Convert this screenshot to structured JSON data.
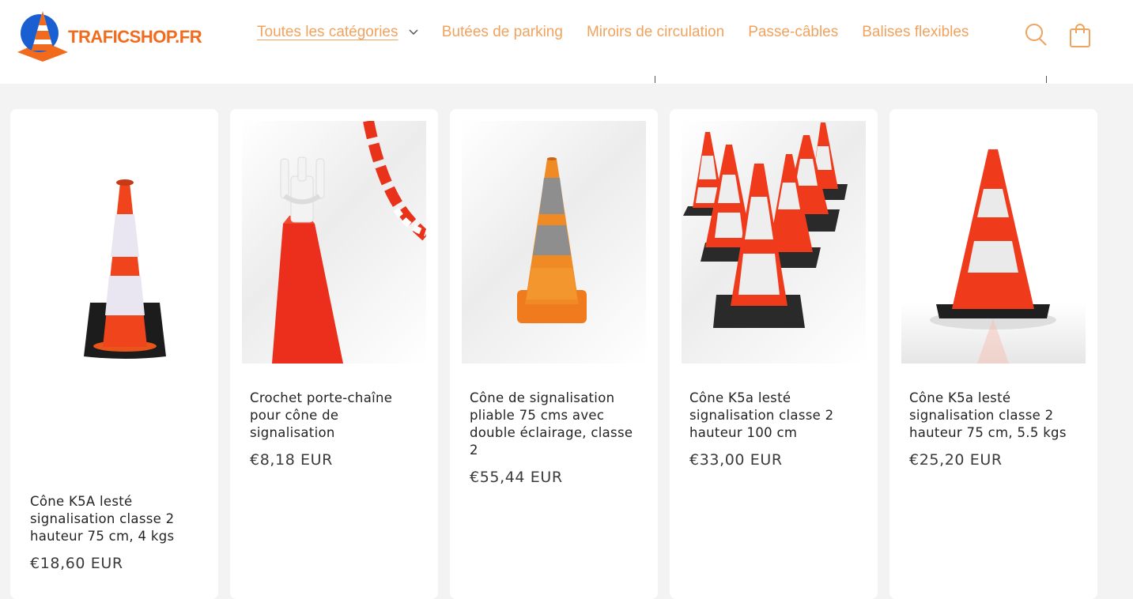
{
  "brand": {
    "name": "TRAFICSHOP.FR",
    "color": "#f26a1b"
  },
  "nav": {
    "items": [
      {
        "label": "Toutes les catégories",
        "has_dropdown": true,
        "active": true
      },
      {
        "label": "Butées de parking"
      },
      {
        "label": "Miroirs de circulation"
      },
      {
        "label": "Passe-câbles"
      },
      {
        "label": "Balises flexibles"
      }
    ],
    "color": "#f0a35e"
  },
  "header_icons": [
    "search-icon",
    "cart-icon"
  ],
  "products": [
    {
      "title": "Cône K5A lesté signalisation classe 2 hauteur 75 cm, 4 kgs",
      "price": "€18,60 EUR",
      "image": "single-cone-icon"
    },
    {
      "title": "Crochet porte-chaîne pour cône de signalisation",
      "price": "€8,18 EUR",
      "image": "chain-hook-icon"
    },
    {
      "title": "Cône de signalisation pliable 75 cms avec double éclairage, classe 2",
      "price": "€55,44 EUR",
      "image": "foldable-cone-icon"
    },
    {
      "title": "Cône K5a lesté signalisation classe 2 hauteur 100 cm",
      "price": "€33,00 EUR",
      "image": "cone-group-icon"
    },
    {
      "title": "Cône K5a lesté signalisation classe 2 hauteur 75 cm, 5.5 kgs",
      "price": "€25,20 EUR",
      "image": "tall-cone-icon"
    }
  ]
}
